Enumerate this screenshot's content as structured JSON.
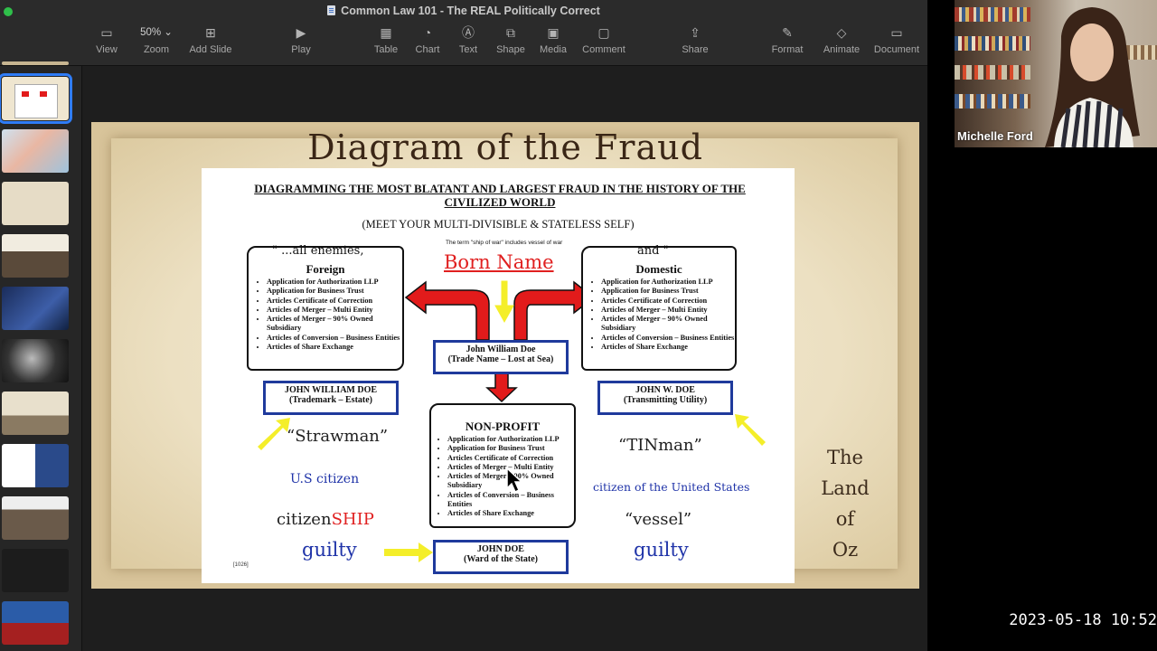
{
  "window": {
    "title": "Common Law 101 - The REAL Politically Correct"
  },
  "toolbar": {
    "view": "View",
    "zoom_value": "50%",
    "zoom": "Zoom",
    "add_slide": "Add Slide",
    "play": "Play",
    "table": "Table",
    "chart": "Chart",
    "text": "Text",
    "shape": "Shape",
    "media": "Media",
    "comment": "Comment",
    "share": "Share",
    "format": "Format",
    "animate": "Animate",
    "document": "Document"
  },
  "slide": {
    "title": "Diagram of the Fraud",
    "side_text": [
      "The Land",
      "of",
      "Oz"
    ],
    "doc": {
      "heading": "DIAGRAMMING THE MOST BLATANT AND LARGEST FRAUD IN THE HISTORY OF THE CIVILIZED WORLD",
      "subheading": "(MEET YOUR MULTI-DIVISIBLE & STATELESS SELF)",
      "note": "The term \"ship of war\" includes vessel of war",
      "born_name": "Born Name",
      "left_caption": "\" ...all enemies,",
      "right_caption": "and \"",
      "foreign": "Foreign",
      "domestic": "Domestic",
      "nonprofit": "NON-PROFIT",
      "items": [
        "Application for Authorization LLP",
        "Application for Business Trust",
        "Articles Certificate of Correction",
        "Articles of Merger – Multi Entity",
        "Articles of Merger – 90% Owned Subsidiary",
        "Articles of Conversion – Business Entities",
        "Articles of Share Exchange"
      ],
      "trade_name_1": "John William Doe",
      "trade_name_2": "(Trade Name – Lost at Sea)",
      "trademark_1": "JOHN WILLIAM DOE",
      "trademark_2": "(Trademark – Estate)",
      "utility_1": "JOHN W. DOE",
      "utility_2": "(Transmitting Utility)",
      "ward_1": "JOHN DOE",
      "ward_2": "(Ward of the State)",
      "strawman": "“Strawman”",
      "tinman": "“TINman”",
      "us_citizen": "U.S citizen",
      "citizen_us": "citizen of the United States",
      "citizen_word": "citizen",
      "ship_word": "SHIP",
      "vessel": "“vessel”",
      "guilty": "guilty",
      "cite": "[1026]"
    }
  },
  "webcam": {
    "name": "Michelle Ford"
  },
  "timestamp": "2023-05-18  10:52",
  "colors": {
    "arrow_red": "#e21b1b",
    "arrow_yellow": "#f4ee2a",
    "box_blue": "#1f3a9c",
    "selection": "#2f7cf6"
  }
}
